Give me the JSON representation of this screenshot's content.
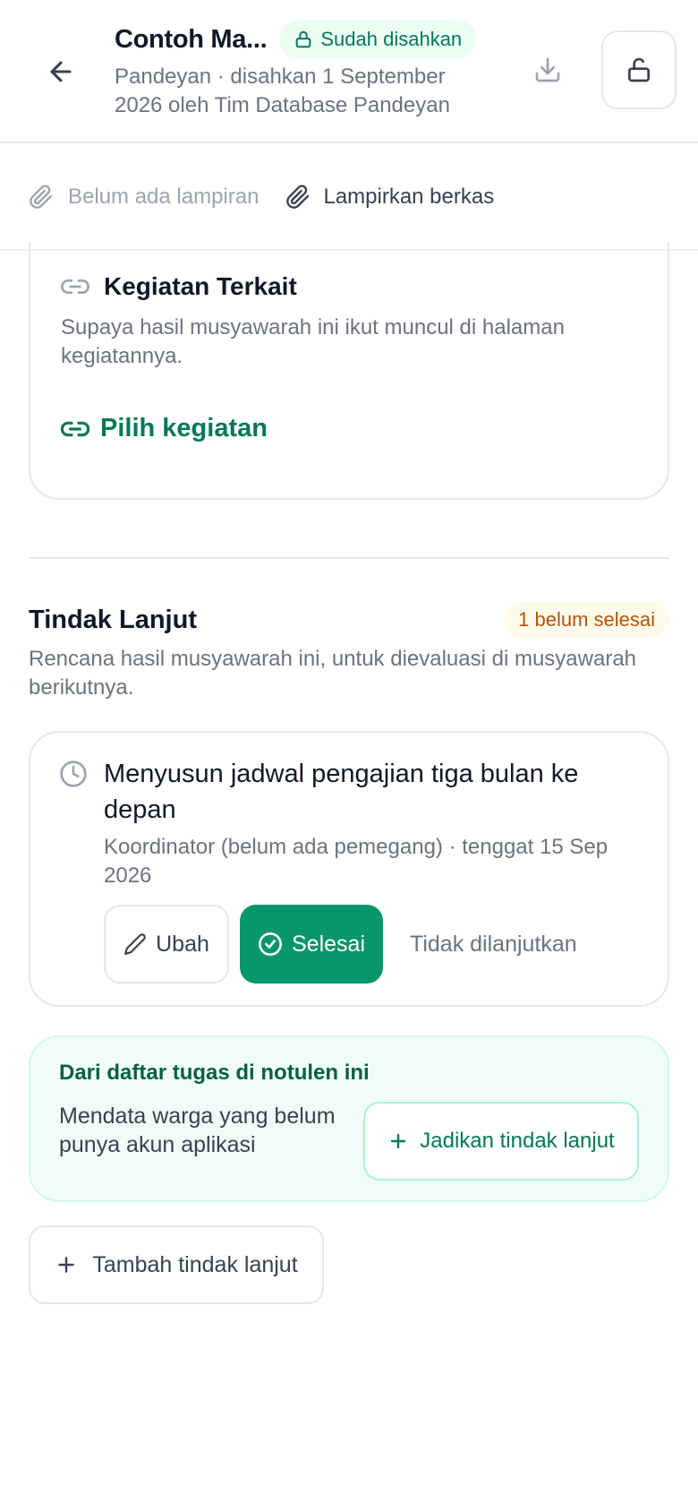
{
  "header": {
    "title": "Contoh Ma...",
    "status": "Sudah disahkan",
    "subtitle": "Pandeyan · disahkan 1 September 2026 oleh Tim Database Pandeyan",
    "icons": {
      "back": "arrow-left-icon",
      "status": "lock-icon",
      "download": "download-icon",
      "unlock": "unlock-icon"
    }
  },
  "attachments": {
    "empty_label": "Belum ada lampiran",
    "attach_label": "Lampirkan berkas"
  },
  "kegiatan": {
    "title": "Kegiatan Terkait",
    "description": "Supaya hasil musyawarah ini ikut muncul di halaman kegiatannya.",
    "link_label": "Pilih kegiatan"
  },
  "tindak_lanjut": {
    "title": "Tindak Lanjut",
    "badge": "1 belum selesai",
    "description": "Rencana hasil musyawarah ini, untuk dievaluasi di musyawarah berikutnya.",
    "task": {
      "title": "Menyusun jadwal pengajian tiga bulan ke depan",
      "meta": "Koordinator (belum ada pemegang) · tenggat 15 Sep 2026",
      "edit_label": "Ubah",
      "done_label": "Selesai",
      "stop_label": "Tidak dilanjutkan"
    },
    "suggestion": {
      "heading": "Dari daftar tugas di notulen ini",
      "text": "Mendata warga yang belum punya akun aplikasi",
      "button_label": "Jadikan tindak lanjut"
    },
    "add_label": "Tambah tindak lanjut"
  },
  "colors": {
    "accent": "#059669",
    "accent_text": "#047857",
    "badge_bg": "#fffbeb",
    "badge_text": "#b45309",
    "muted": "#6b7280"
  }
}
